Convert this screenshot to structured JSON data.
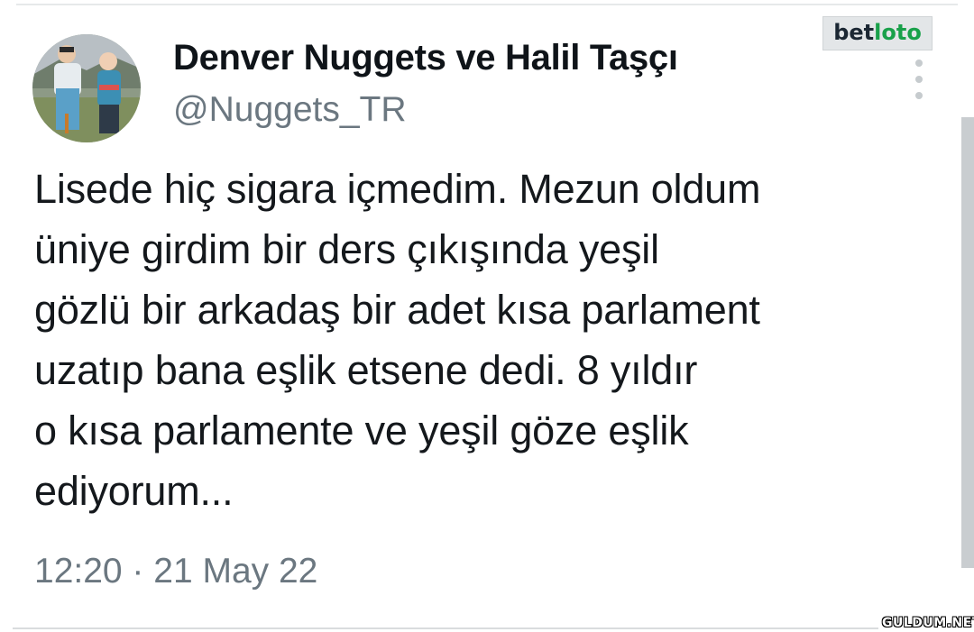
{
  "tweet": {
    "author_name": "Denver Nuggets ve Halil Taşçı",
    "author_handle": "@Nuggets_TR",
    "text_lines": [
      "Lisede hiç sigara içmedim. Mezun oldum",
      "üniye girdim bir ders çıkışında yeşil",
      "gözlü bir arkadaş bir adet kısa parlament",
      "uzatıp bana eşlik etsene dedi. 8 yıldır",
      "o kısa parlamente ve yeşil göze eşlik",
      "ediyorum..."
    ],
    "timestamp": "12:20 · 21 May 22"
  },
  "brand_logo": {
    "part_a": "bet",
    "part_b": "loto"
  },
  "watermark": "GULDUM.NET",
  "icons": {
    "more": "more-vertical-icon",
    "avatar": "avatar-photo"
  },
  "colors": {
    "text": "#0f1419",
    "secondary_text": "#6b7780",
    "logo_green": "#19a14a"
  }
}
